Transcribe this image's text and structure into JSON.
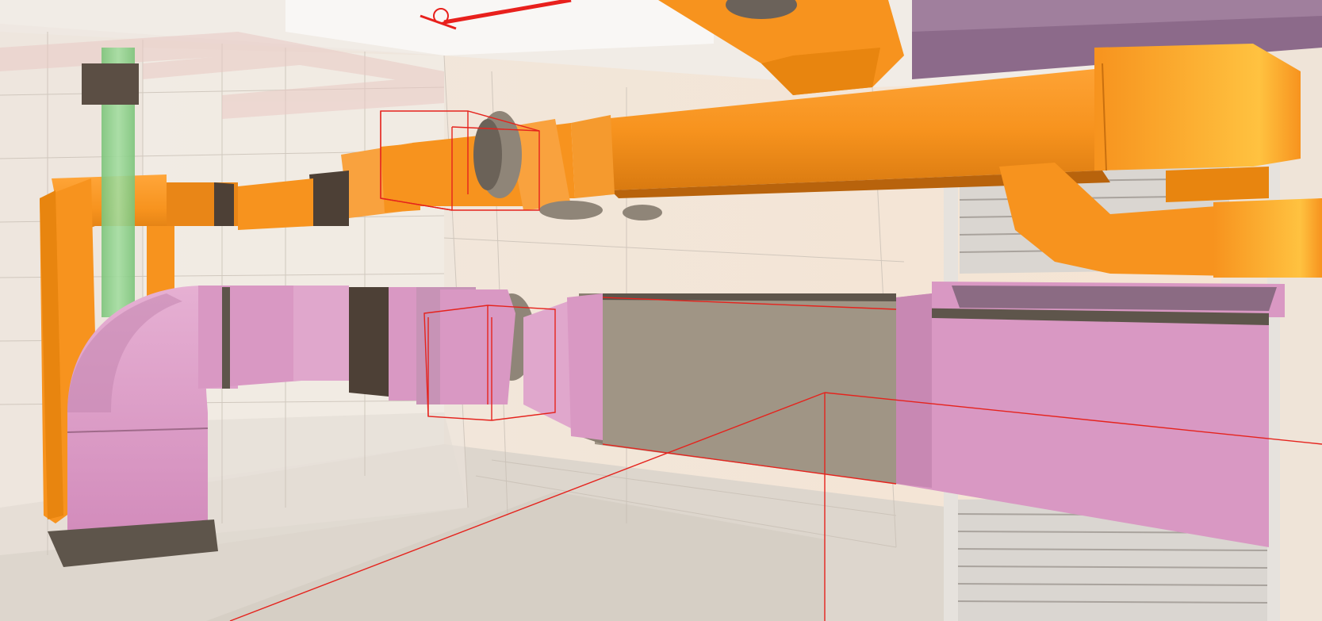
{
  "scene": {
    "type": "3d-bim-model-viewport",
    "elements": [
      "building-room-shell",
      "upper-orange-supply-duct-run",
      "lower-pink-return-duct-run",
      "grey-duct-section",
      "green-vertical-pipe",
      "orange-vertical-riser",
      "red-sprinkler-pipe",
      "rolling-shutter-door",
      "selection-bounding-boxes"
    ],
    "colors": {
      "supply_duct": "#f7931e",
      "supply_duct_shadow": "#c96f0e",
      "return_duct": "#d998c3",
      "return_duct_shadow": "#b9779f",
      "grey_duct": "#a09585",
      "pipe_green": "#8fd18a",
      "sprinkler_pipe": "#e8201c",
      "selection_outline": "#e5231d",
      "wall": "#f3e7da",
      "floor": "#ddd6cd",
      "shutter": "#d9d6d2",
      "purple_duct": "#8c6a8a"
    }
  }
}
